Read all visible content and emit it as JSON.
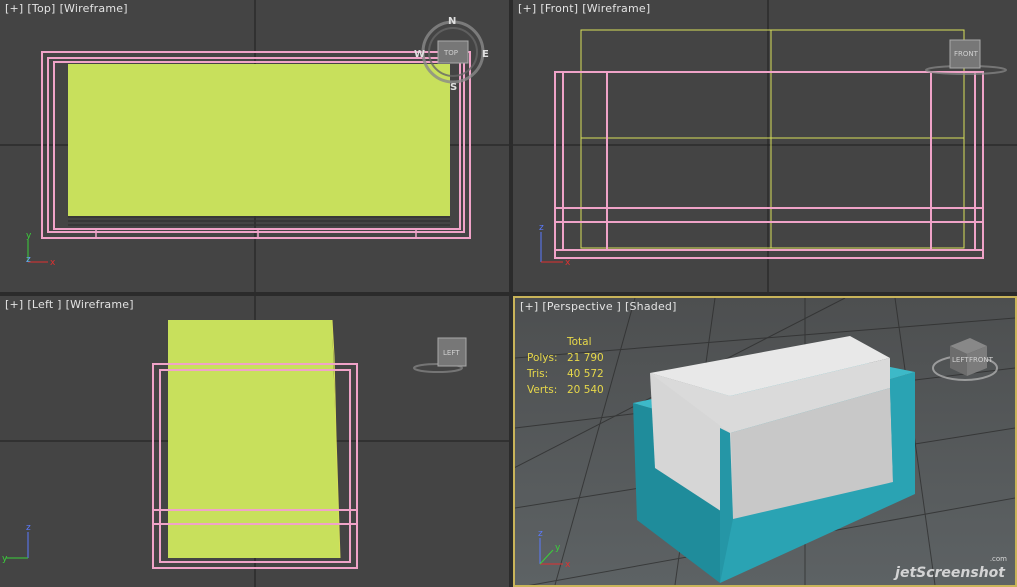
{
  "viewports": {
    "top": {
      "plus": "[+]",
      "view": "[Top]",
      "mode": "[Wireframe]"
    },
    "front": {
      "plus": "[+]",
      "view": "[Front]",
      "mode": "[Wireframe]"
    },
    "left": {
      "plus": "[+]",
      "view": "[Left ]",
      "mode": "[Wireframe]"
    },
    "perspective": {
      "plus": "[+]",
      "view": "[Perspective ]",
      "mode": "[Shaded]"
    }
  },
  "compass": {
    "n": "N",
    "s": "S",
    "e": "E",
    "w": "W"
  },
  "viewcube": {
    "top": "TOP",
    "front": "FRONT",
    "left": "LEFT",
    "persp_left": "LEFT",
    "persp_front": "FRONT"
  },
  "axes": {
    "x": "x",
    "y": "y",
    "z": "z"
  },
  "stats": {
    "header": "Total",
    "polys_label": "Polys:",
    "polys": "21 790",
    "tris_label": "Tris:",
    "tris": "40 572",
    "verts_label": "Verts:",
    "verts": "20 540"
  },
  "watermark": {
    "text": "jetScreenshot",
    "domain": ".com"
  },
  "colors": {
    "viewport_bg": "#444444",
    "wire_pink": "#f0a3c8",
    "wire_yellow": "#d8e05a",
    "fill_green": "#c8e05c",
    "sofa_teal": "#2aa3b3",
    "cushion_white": "#e6e6e6",
    "active_border": "#c9b45a",
    "stats_text": "#e7d84a"
  }
}
